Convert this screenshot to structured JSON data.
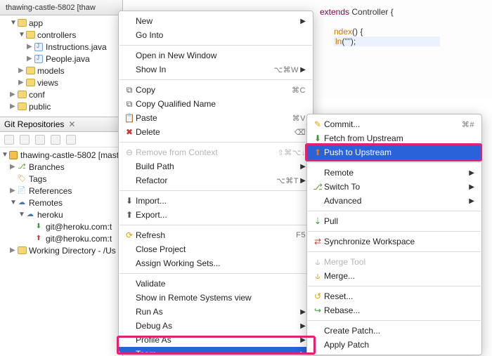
{
  "projectExplorer": {
    "title": "thawing-castle-5802 [thaw",
    "root": "app",
    "controllers": "controllers",
    "instructions": "Instructions.java",
    "people": "People.java",
    "models": "models",
    "views": "views",
    "conf": "conf",
    "public": "public"
  },
  "gitView": {
    "title": "Git Repositories",
    "repo": "thawing-castle-5802 [mast",
    "branches": "Branches",
    "tags": "Tags",
    "references": "References",
    "remotes": "Remotes",
    "heroku": "heroku",
    "fetch": "git@heroku.com:t",
    "push": "git@heroku.com:t",
    "workingDir": "Working Directory - /Us"
  },
  "editor": {
    "line1a": "extends",
    "line1b": " Controller {",
    "line2a": "ndex",
    "line2b": "() {",
    "line3a": "ln",
    "line3b": "(",
    "line3c": "\"\"",
    "line3d": ");"
  },
  "menu": {
    "new": "New",
    "goInto": "Go Into",
    "openNew": "Open in New Window",
    "showIn": "Show In",
    "showInShort": "⌥⌘W",
    "copy": "Copy",
    "copyShort": "⌘C",
    "copyQualified": "Copy Qualified Name",
    "paste": "Paste",
    "pasteShort": "⌘V",
    "delete": "Delete",
    "deleteShort": "⌫",
    "removeCtx": "Remove from Context",
    "removeCtxShort": "⇧⌘⌥↓",
    "buildPath": "Build Path",
    "refactor": "Refactor",
    "refactorShort": "⌥⌘T",
    "import": "Import...",
    "export": "Export...",
    "refresh": "Refresh",
    "refreshShort": "F5",
    "closeProject": "Close Project",
    "assignWS": "Assign Working Sets...",
    "validate": "Validate",
    "showRemote": "Show in Remote Systems view",
    "runAs": "Run As",
    "debugAs": "Debug As",
    "profileAs": "Profile As",
    "team": "Team"
  },
  "submenu": {
    "commit": "Commit...",
    "commitShort": "⌘#",
    "fetchUpstream": "Fetch from Upstream",
    "pushUpstream": "Push to Upstream",
    "remote": "Remote",
    "switchTo": "Switch To",
    "advanced": "Advanced",
    "pull": "Pull",
    "syncWs": "Synchronize Workspace",
    "mergeTool": "Merge Tool",
    "merge": "Merge...",
    "reset": "Reset...",
    "rebase": "Rebase...",
    "createPatch": "Create Patch...",
    "applyPatch": "Apply Patch"
  }
}
